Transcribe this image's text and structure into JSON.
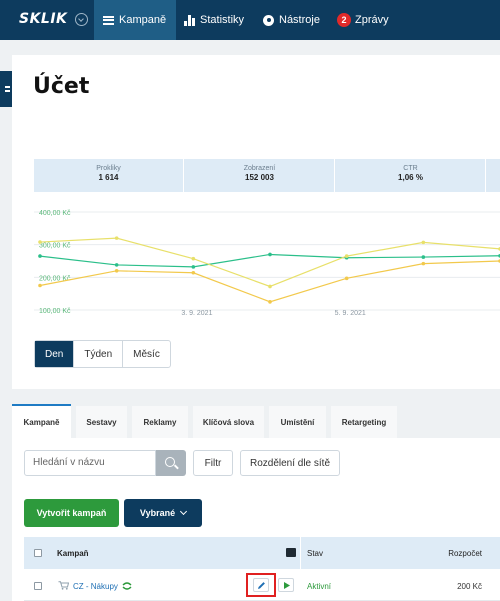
{
  "nav": {
    "logo": "SKLIK",
    "items": [
      {
        "label": "Kampaně",
        "icon": "menu-icon",
        "active": true
      },
      {
        "label": "Statistiky",
        "icon": "bar-chart-icon"
      },
      {
        "label": "Nástroje",
        "icon": "gear-icon"
      },
      {
        "label": "Zprávy",
        "icon": "notification-badge",
        "badge": "2"
      }
    ]
  },
  "page": {
    "title": "Účet"
  },
  "stats": [
    {
      "label": "Prokliky",
      "value": "1 614"
    },
    {
      "label": "Zobrazení",
      "value": "152 003"
    },
    {
      "label": "CTR",
      "value": "1,06 %"
    }
  ],
  "chart_data": {
    "type": "line",
    "y_tick_labels": [
      "400,00 Kč",
      "300,00 Kč",
      "200,00 Kč",
      "100,00 Kč"
    ],
    "ylim": [
      100,
      400
    ],
    "x": [
      1,
      2,
      3,
      4,
      5,
      6,
      7
    ],
    "x_tick_labels": {
      "3": "3. 9. 2021",
      "5": "5. 9. 2021"
    },
    "series": [
      {
        "color": "#2bbf8a",
        "values": [
          265,
          238,
          232,
          270,
          260,
          262,
          266
        ]
      },
      {
        "color": "#e8e06a",
        "values": [
          308,
          320,
          257,
          172,
          265,
          307,
          287
        ]
      },
      {
        "color": "#f2c94c",
        "values": [
          175,
          220,
          214,
          125,
          197,
          242,
          250
        ]
      }
    ],
    "grid": true
  },
  "period": {
    "options": [
      "Den",
      "Týden",
      "Měsíc"
    ],
    "selected": "Den"
  },
  "tabs": [
    "Kampaně",
    "Sestavy",
    "Reklamy",
    "Klíčová slova",
    "Umístění",
    "Retargeting"
  ],
  "filters": {
    "search_placeholder": "Hledání v názvu",
    "filter_label": "Filtr",
    "split_label": "Rozdělení dle sítě"
  },
  "actions": {
    "create": "Vytvořit kampaň",
    "selected": "Vybrané"
  },
  "table": {
    "headers": {
      "campaign": "Kampaň",
      "status": "Stav",
      "budget": "Rozpočet"
    },
    "rows": [
      {
        "name": "CZ - Nákupy",
        "status": "Aktivní",
        "budget": "200 Kč"
      }
    ]
  },
  "colors": {
    "nav_bg": "#0d3b5e",
    "accent": "#1e7bc4",
    "green": "#2d9a3c",
    "highlight": "#e02020"
  }
}
